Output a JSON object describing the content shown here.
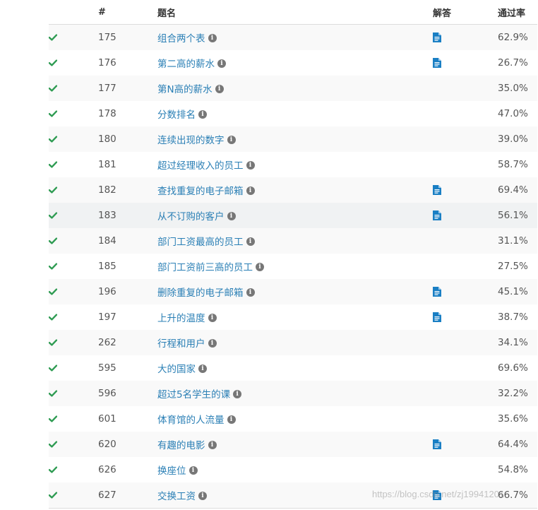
{
  "header": {
    "col_id": "#",
    "col_title": "题名",
    "col_solution": "解答",
    "col_rate": "通过率"
  },
  "colors": {
    "check": "#2e9b52",
    "link": "#2a7fb5",
    "doc": "#1a7fc4",
    "info": "#777777"
  },
  "icons": {
    "status": "check-icon",
    "info": "info-icon",
    "solution": "document-icon"
  },
  "rows": [
    {
      "id": "175",
      "title": "组合两个表",
      "solution": true,
      "rate": "62.9%"
    },
    {
      "id": "176",
      "title": "第二高的薪水",
      "solution": true,
      "rate": "26.7%"
    },
    {
      "id": "177",
      "title": "第N高的薪水",
      "solution": false,
      "rate": "35.0%"
    },
    {
      "id": "178",
      "title": "分数排名",
      "solution": false,
      "rate": "47.0%"
    },
    {
      "id": "180",
      "title": "连续出现的数字",
      "solution": false,
      "rate": "39.0%"
    },
    {
      "id": "181",
      "title": "超过经理收入的员工",
      "solution": false,
      "rate": "58.7%"
    },
    {
      "id": "182",
      "title": "查找重复的电子邮箱",
      "solution": true,
      "rate": "69.4%"
    },
    {
      "id": "183",
      "title": "从不订购的客户",
      "solution": true,
      "rate": "56.1%",
      "hover": true
    },
    {
      "id": "184",
      "title": "部门工资最高的员工",
      "solution": false,
      "rate": "31.1%"
    },
    {
      "id": "185",
      "title": "部门工资前三高的员工",
      "solution": false,
      "rate": "27.5%"
    },
    {
      "id": "196",
      "title": "删除重复的电子邮箱",
      "solution": true,
      "rate": "45.1%"
    },
    {
      "id": "197",
      "title": "上升的温度",
      "solution": true,
      "rate": "38.7%"
    },
    {
      "id": "262",
      "title": "行程和用户",
      "solution": false,
      "rate": "34.1%"
    },
    {
      "id": "595",
      "title": "大的国家",
      "solution": false,
      "rate": "69.6%"
    },
    {
      "id": "596",
      "title": "超过5名学生的课",
      "solution": false,
      "rate": "32.2%"
    },
    {
      "id": "601",
      "title": "体育馆的人流量",
      "solution": false,
      "rate": "35.6%"
    },
    {
      "id": "620",
      "title": "有趣的电影",
      "solution": true,
      "rate": "64.4%"
    },
    {
      "id": "626",
      "title": "换座位",
      "solution": false,
      "rate": "54.8%"
    },
    {
      "id": "627",
      "title": "交换工资",
      "solution": true,
      "rate": "66.7%"
    }
  ],
  "watermark": "https://blog.csdn.net/zj19941201"
}
